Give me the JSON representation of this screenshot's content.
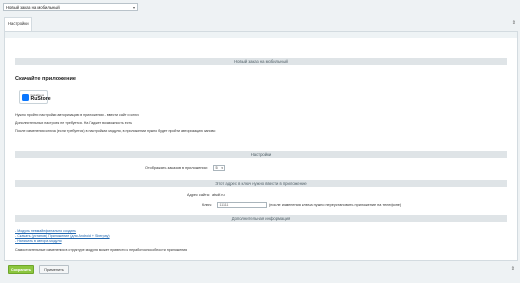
{
  "top_select": {
    "value": "Новый заказ на мобильный"
  },
  "tabs": [
    {
      "label": "Настройки"
    }
  ],
  "sections": {
    "main": "Новый заказ на мобильный",
    "settings": "Настройки",
    "address": "Этот адрес в ключ нужно ввести в приложение",
    "info": "Дополнительная информация"
  },
  "app": {
    "title": "Скачайте приложение",
    "badge_small": "Скачайте из",
    "badge_big": "RuStore",
    "lines": [
      "Нужно пройти настройки авторизацию в приложении - ввести сайт и ключ",
      "Дополнительных настроек не требуется. На Гаджет возможность есть",
      "После изменения ключа (если требуется) в настройках модуля, в приложении нужно будет пройти авторизацию заново"
    ]
  },
  "settings": {
    "orders_label": "Отображать заказов в приложении:",
    "orders_value": "5"
  },
  "address": {
    "site_label": "Адрес сайта:",
    "site_value": "atsdf.ru",
    "key_label": "Ключ:",
    "key_value": "11111",
    "key_note": "(после изменения ключа нужно переустановить приложение на телефоне)"
  },
  "info": {
    "links": [
      "- Модуль невмайнфинально создать",
      "- Скачать (установ) Приложение (для Android + Sberpay)",
      "- Написать в автора модуля"
    ],
    "note": "Самостоятельные изменения в структуре модуля может привести к неработоспособности приложения"
  },
  "footer": {
    "save": "Сохранить",
    "apply": "Применить"
  }
}
